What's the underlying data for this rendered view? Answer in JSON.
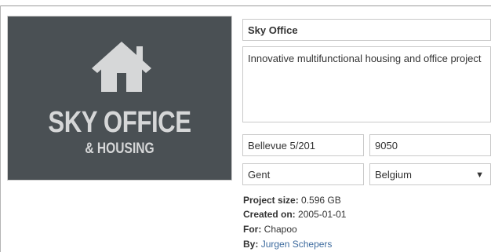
{
  "project": {
    "logo_title": "SKY OFFICE",
    "logo_subtitle": "& HOUSING",
    "logo_icon": "house-icon",
    "name": "Sky Office",
    "description": "Innovative multifunctional housing and office project",
    "address": "Bellevue 5/201",
    "zip": "9050",
    "city": "Gent",
    "country": "Belgium",
    "caret_icon": "chevron-down-icon"
  },
  "meta": {
    "size_label": "Project size:",
    "size_value": "0.596 GB",
    "created_label": "Created on:",
    "created_value": "2005-01-01",
    "for_label": "For:",
    "for_value": "Chapoo",
    "by_label": "By:",
    "by_value": "Jurgen Schepers"
  },
  "colors": {
    "logo_bg": "#4a5054",
    "logo_fg": "#d6d7d8",
    "link": "#3c6a9e"
  }
}
